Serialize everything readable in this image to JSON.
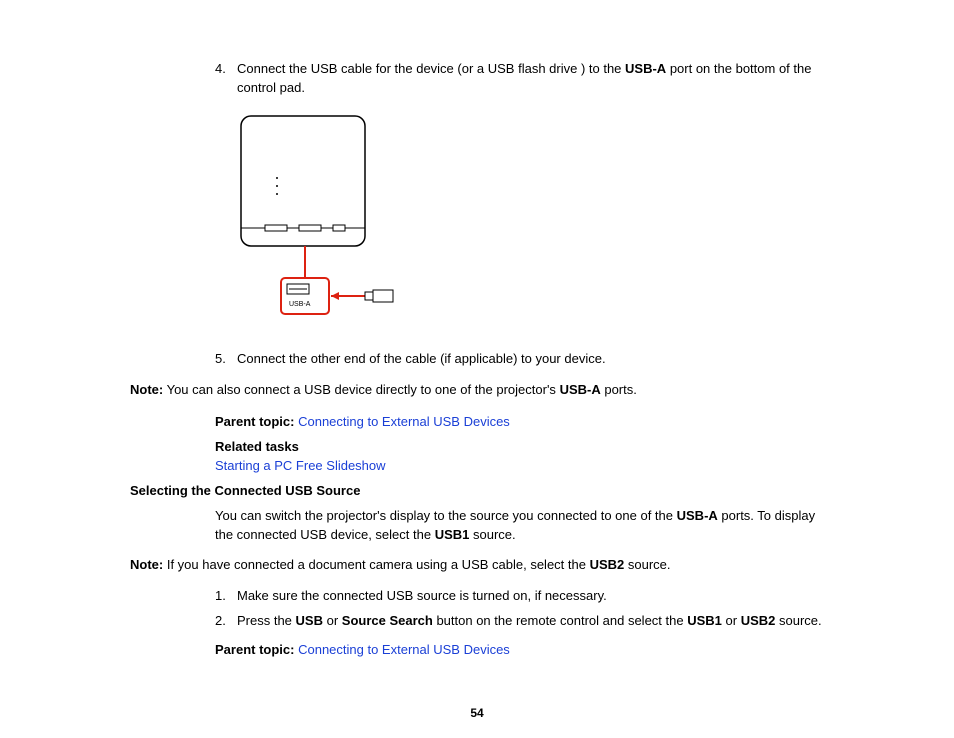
{
  "step4": {
    "num": "4.",
    "text_a": "Connect the USB cable for the device (or a USB flash drive ) to the ",
    "bold1": "USB-A",
    "text_b": " port on the bottom of the control pad."
  },
  "figure": {
    "usb_label": "USB-A"
  },
  "step5": {
    "num": "5.",
    "text": "Connect the other end of the cable (if applicable) to your device."
  },
  "note1": {
    "label": "Note:",
    "text_a": " You can also connect a USB device directly to one of the projector's ",
    "bold1": "USB-A",
    "text_b": " ports."
  },
  "parent1": {
    "label": "Parent topic:",
    "link": "Connecting to External USB Devices"
  },
  "related": {
    "label": "Related tasks",
    "link": "Starting a PC Free Slideshow"
  },
  "heading2": "Selecting the Connected USB Source",
  "para2": {
    "text_a": "You can switch the projector's display to the source you connected to one of the ",
    "bold1": "USB-A",
    "text_b": " ports. To display the connected USB device, select the ",
    "bold2": "USB1",
    "text_c": " source."
  },
  "note2": {
    "label": "Note:",
    "text_a": " If you have connected a document camera using a USB cable, select the ",
    "bold1": "USB2",
    "text_b": " source."
  },
  "step_s1": {
    "num": "1.",
    "text": "Make sure the connected USB source is turned on, if necessary."
  },
  "step_s2": {
    "num": "2.",
    "text_a": "Press the ",
    "bold1": "USB",
    "text_b": " or ",
    "bold2": "Source Search",
    "text_c": " button on the remote control and select the ",
    "bold3": "USB1",
    "text_d": " or ",
    "bold4": "USB2",
    "text_e": " source."
  },
  "parent2": {
    "label": "Parent topic:",
    "link": "Connecting to External USB Devices"
  },
  "page_number": "54"
}
